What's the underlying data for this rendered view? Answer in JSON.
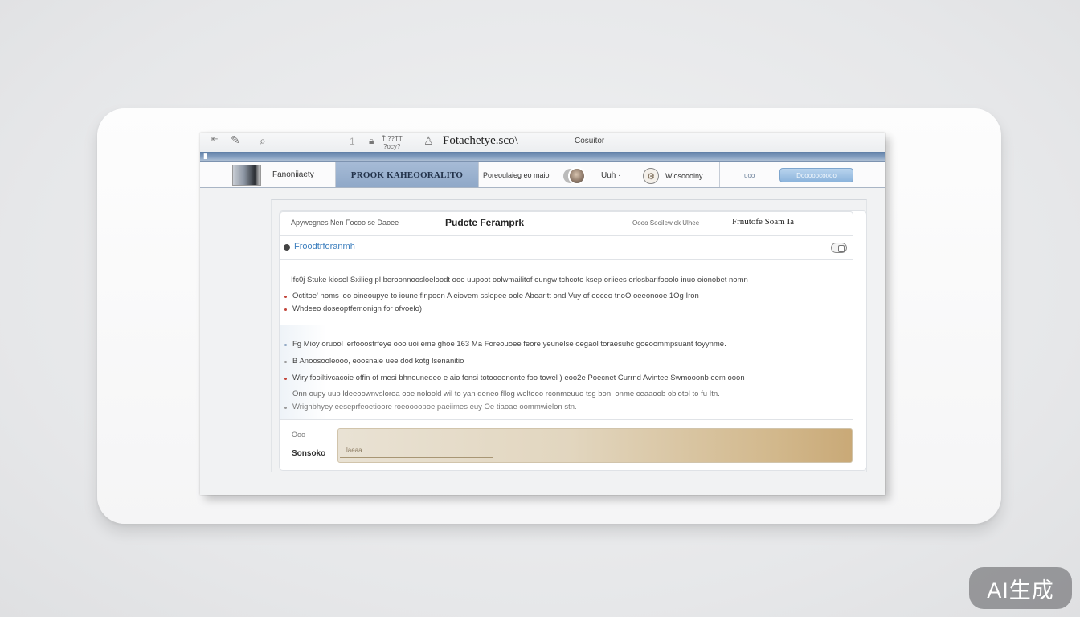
{
  "titlebar": {
    "title": "Fotachetye.sco\\",
    "subtitle": "Cosuitor",
    "small_a": "T̄ ??TT",
    "small_b": "?ocy?",
    "num": "1"
  },
  "toolbar": {
    "profile_label": "Fanoniiaety",
    "active_tab": "PROOK KAHEOORALITO",
    "search_text": "Poreoulaieg eo maio",
    "user_label": "Uuh ·",
    "settings_label": "Wlosoooiny",
    "right_label": "uoo",
    "right_button": "Dooooocoooo"
  },
  "panel": {
    "crumb": "Apywegnes Nen Focoo se Daoee",
    "title": "Pudcte Feramprk",
    "meta": "Oooo Sooilewlok Ulhee",
    "status": "Frnutofe Soam Ia",
    "link": "Froodtrforanmh",
    "section1": [
      "Ifc0j Stuke kiosel Sxilieg pl beroonnoosloeloodt ooo uupoot oolwmailitof oungw tchcoto ksep oriiees orlosbarifooolo inuo oionobet nomn",
      "Octitoe' noms loo oineoupye to ioune flnpoon A eiovem sslepee oole Abearitt ond Vuy of eoceo tnoO oeeonooe 1Og Iron",
      "Whdeeo doseoptfemonign for ofvoelo)"
    ],
    "section2": [
      "Fg Mioy oruool ierfooostrfeye ooo uoi eme ghoe 163 Ma Foreouoee feore yeunelse oegaol toraesuhc goeoommpsuant toyynme.",
      "B Anoosooleooo, eoosnaie uee dod kotg lsenanitio",
      "Wiry fooiltivcacoie offin of mesi bhnounedeo e aio fensi totooeenonte foo towel ) eoo2e Poecnet Currnd Avintee Swmooonb eem ooon",
      "Onn oupy uup ldeeoownvslorea ooe noloold wil to yan deneo fllog weltooo rconmeuuo tsg bon, onme ceaaoob obiotol to fu Itn.",
      "Wrighbhyey eeseprfeoetioore roeoooopoe paeiimes euy Oe tiaoae oommwielon stn."
    ],
    "foot_label_1": "Ooo",
    "foot_label_2": "Sonsoko",
    "foot_placeholder": "laeaa"
  },
  "badge": "AI生成"
}
